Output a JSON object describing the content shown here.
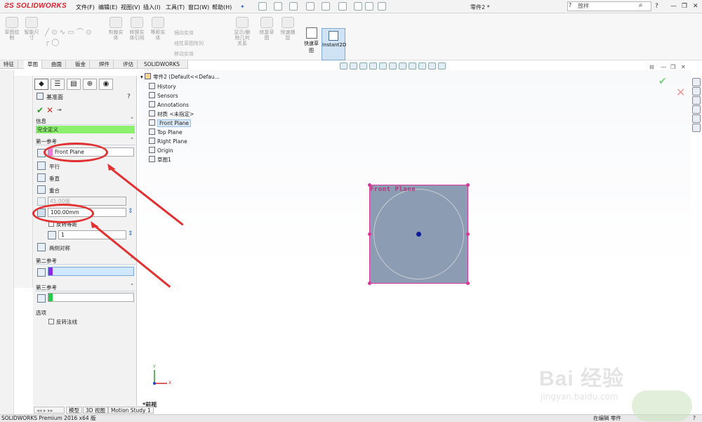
{
  "app": {
    "logo_text": "SOLIDWORKS",
    "menu": [
      "文件(F)",
      "编辑(E)",
      "视图(V)",
      "插入(I)",
      "工具(T)",
      "窗口(W)",
      "帮助(H)"
    ],
    "document_title": "零件2 *",
    "search_placeholder": "放样",
    "help_label": "?"
  },
  "ribbon": {
    "buttons": [
      "草图绘制",
      "智能尺寸"
    ],
    "group_labels": [
      "剪裁实体",
      "转换实体引用",
      "等距实体",
      "显示/删除几何关系",
      "修复草图",
      "快速捕捉"
    ],
    "small_items": [
      "镜向实体",
      "线性草图阵列",
      "移动实体"
    ],
    "quick_sketch": "快速草图",
    "instant2d": "Instant2D"
  },
  "command_tabs": [
    "特征",
    "草图",
    "曲面",
    "钣金",
    "焊件",
    "评估",
    "SOLIDWORKS 插件"
  ],
  "property_manager": {
    "title": "基准面",
    "help": "?",
    "message_header": "信息",
    "status": "完全定义",
    "first_ref": {
      "header": "第一参考",
      "value": "Front Plane",
      "options": [
        "平行",
        "垂直",
        "重合"
      ],
      "angle_value": "45.00度",
      "distance_value": "100.00mm",
      "flip_label": "反转等距",
      "count_value": "1",
      "mirror_label": "两侧对称"
    },
    "second_ref": {
      "header": "第二参考"
    },
    "third_ref": {
      "header": "第三参考"
    },
    "options": {
      "header": "选项",
      "flip_normal": "反转法线"
    }
  },
  "feature_tree": {
    "root": "零件2 (Default<<Defau...",
    "items": [
      "History",
      "Sensors",
      "Annotations",
      "材质 <未指定>",
      "Front Plane",
      "Top Plane",
      "Right Plane",
      "Origin",
      "草图1"
    ],
    "selected_index": 4
  },
  "viewport": {
    "plane_label": "Front Plane",
    "view_name": "*前视",
    "axis_x": "X",
    "axis_y": "Y"
  },
  "bottom_tabs": [
    "模型",
    "3D 视图",
    "Motion Study 1"
  ],
  "statusbar": {
    "left": "SOLIDWORKS Premium 2016 x64 版",
    "mode": "在编辑 零件"
  },
  "watermark": {
    "logo": "Bai 经验",
    "url": "jingyan.baidu.com"
  },
  "colors": {
    "accent_red": "#e03232",
    "status_green": "#8cf06e",
    "plane_fill": "#8c9cb3",
    "plane_border": "#d6389a"
  }
}
